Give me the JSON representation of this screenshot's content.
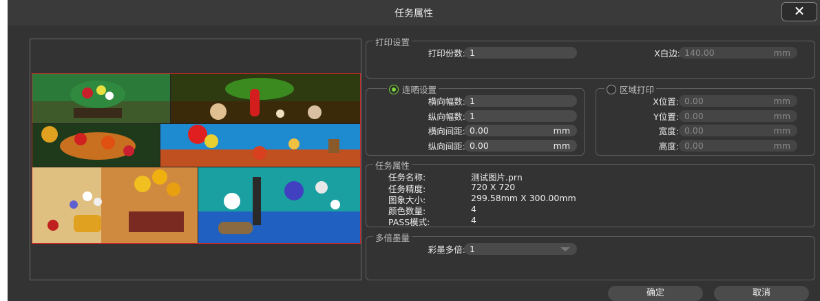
{
  "window": {
    "title": "任务属性"
  },
  "print_settings": {
    "legend": "打印设置",
    "copies_label": "打印份数:",
    "copies_value": "1",
    "x_margin_label": "X白边:",
    "x_margin_value": "140.00",
    "x_margin_unit": "mm"
  },
  "tile_settings": {
    "legend": "连晒设置",
    "selected": true,
    "h_count_label": "横向幅数:",
    "h_count_value": "1",
    "v_count_label": "纵向幅数:",
    "v_count_value": "1",
    "h_gap_label": "横向间距:",
    "h_gap_value": "0.00",
    "h_gap_unit": "mm",
    "v_gap_label": "纵向间距:",
    "v_gap_value": "0.00",
    "v_gap_unit": "mm"
  },
  "region_print": {
    "legend": "区域打印",
    "selected": false,
    "x_label": "X位置:",
    "x_value": "0.00",
    "x_unit": "mm",
    "y_label": "Y位置:",
    "y_value": "0.00",
    "y_unit": "mm",
    "w_label": "宽度:",
    "w_value": "0.00",
    "w_unit": "mm",
    "h_label": "高度:",
    "h_value": "0.00",
    "h_unit": "mm"
  },
  "task_props": {
    "legend": "任务属性",
    "rows": [
      {
        "key": "任务名称:",
        "value": "测试图片.prn"
      },
      {
        "key": "任务精度:",
        "value": "720 X 720"
      },
      {
        "key": "图象大小:",
        "value": "299.58mm X 300.00mm"
      },
      {
        "key": "颜色数量:",
        "value": "4"
      },
      {
        "key": "PASS模式:",
        "value": "4"
      }
    ]
  },
  "multi_ink": {
    "legend": "多倍墨量",
    "color_multi_label": "彩墨多倍:",
    "color_multi_value": "1"
  },
  "buttons": {
    "ok": "确定",
    "cancel": "取消"
  },
  "icons": {
    "close": "close-icon"
  },
  "colors": {
    "background": "#333333",
    "accent_radio": "#7ad63a",
    "preview_border": "#c82828"
  }
}
